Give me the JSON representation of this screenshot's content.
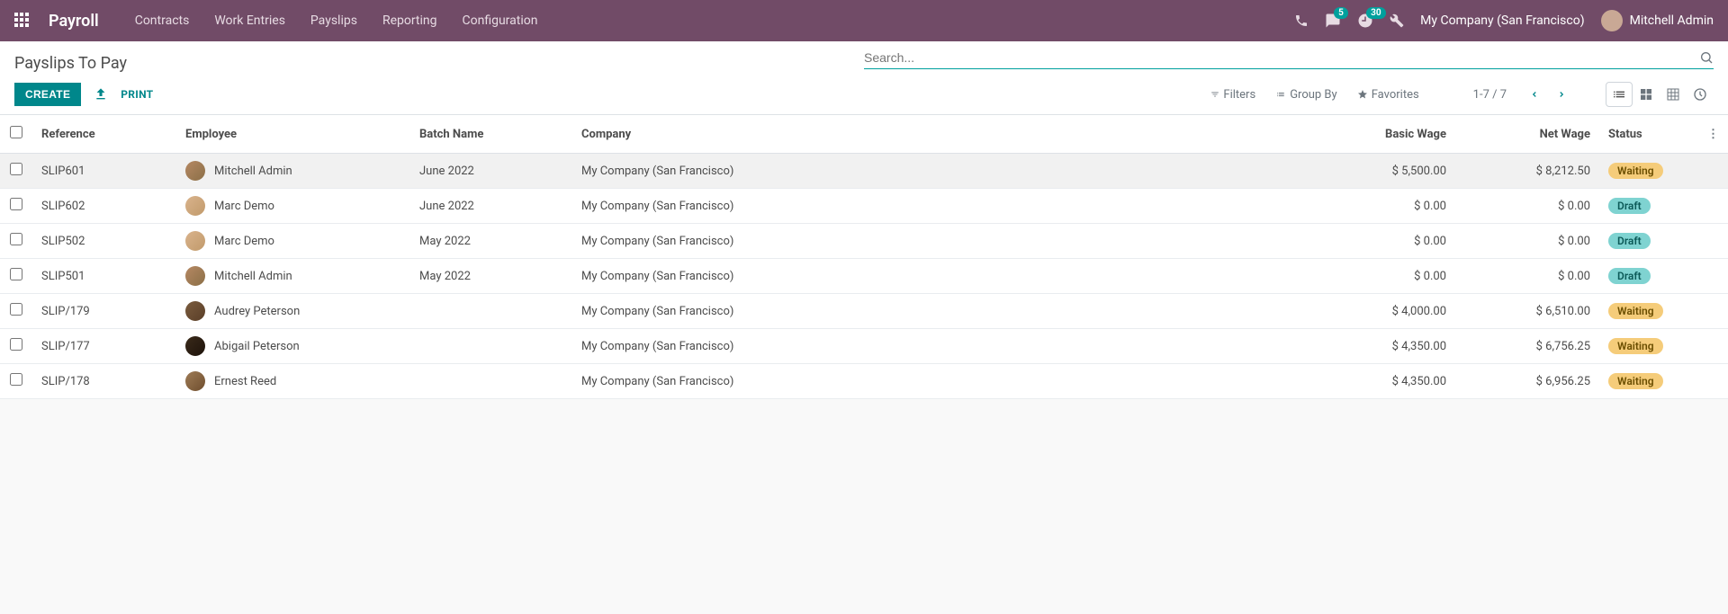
{
  "navbar": {
    "brand": "Payroll",
    "menu": [
      "Contracts",
      "Work Entries",
      "Payslips",
      "Reporting",
      "Configuration"
    ],
    "messaging_badge": "5",
    "activities_badge": "30",
    "company": "My Company (San Francisco)",
    "user": "Mitchell Admin"
  },
  "control": {
    "title": "Payslips To Pay",
    "search_placeholder": "Search...",
    "create_label": "CREATE",
    "print_label": "PRINT",
    "filters_label": "Filters",
    "groupby_label": "Group By",
    "favorites_label": "Favorites",
    "pager": "1-7 / 7"
  },
  "table": {
    "headers": {
      "reference": "Reference",
      "employee": "Employee",
      "batch": "Batch Name",
      "company": "Company",
      "basic": "Basic Wage",
      "net": "Net Wage",
      "status": "Status"
    },
    "rows": [
      {
        "reference": "SLIP601",
        "employee": "Mitchell Admin",
        "avatar": "ava1",
        "batch": "June 2022",
        "company": "My Company (San Francisco)",
        "basic": "$ 5,500.00",
        "net": "$ 8,212.50",
        "status": "Waiting",
        "status_class": "status-waiting",
        "highlight": true
      },
      {
        "reference": "SLIP602",
        "employee": "Marc Demo",
        "avatar": "ava2",
        "batch": "June 2022",
        "company": "My Company (San Francisco)",
        "basic": "$ 0.00",
        "net": "$ 0.00",
        "status": "Draft",
        "status_class": "status-draft"
      },
      {
        "reference": "SLIP502",
        "employee": "Marc Demo",
        "avatar": "ava2",
        "batch": "May 2022",
        "company": "My Company (San Francisco)",
        "basic": "$ 0.00",
        "net": "$ 0.00",
        "status": "Draft",
        "status_class": "status-draft"
      },
      {
        "reference": "SLIP501",
        "employee": "Mitchell Admin",
        "avatar": "ava1",
        "batch": "May 2022",
        "company": "My Company (San Francisco)",
        "basic": "$ 0.00",
        "net": "$ 0.00",
        "status": "Draft",
        "status_class": "status-draft"
      },
      {
        "reference": "SLIP/179",
        "employee": "Audrey Peterson",
        "avatar": "ava3",
        "batch": "",
        "company": "My Company (San Francisco)",
        "basic": "$ 4,000.00",
        "net": "$ 6,510.00",
        "status": "Waiting",
        "status_class": "status-waiting"
      },
      {
        "reference": "SLIP/177",
        "employee": "Abigail Peterson",
        "avatar": "ava4",
        "batch": "",
        "company": "My Company (San Francisco)",
        "basic": "$ 4,350.00",
        "net": "$ 6,756.25",
        "status": "Waiting",
        "status_class": "status-waiting"
      },
      {
        "reference": "SLIP/178",
        "employee": "Ernest Reed",
        "avatar": "ava5",
        "batch": "",
        "company": "My Company (San Francisco)",
        "basic": "$ 4,350.00",
        "net": "$ 6,956.25",
        "status": "Waiting",
        "status_class": "status-waiting"
      }
    ]
  }
}
